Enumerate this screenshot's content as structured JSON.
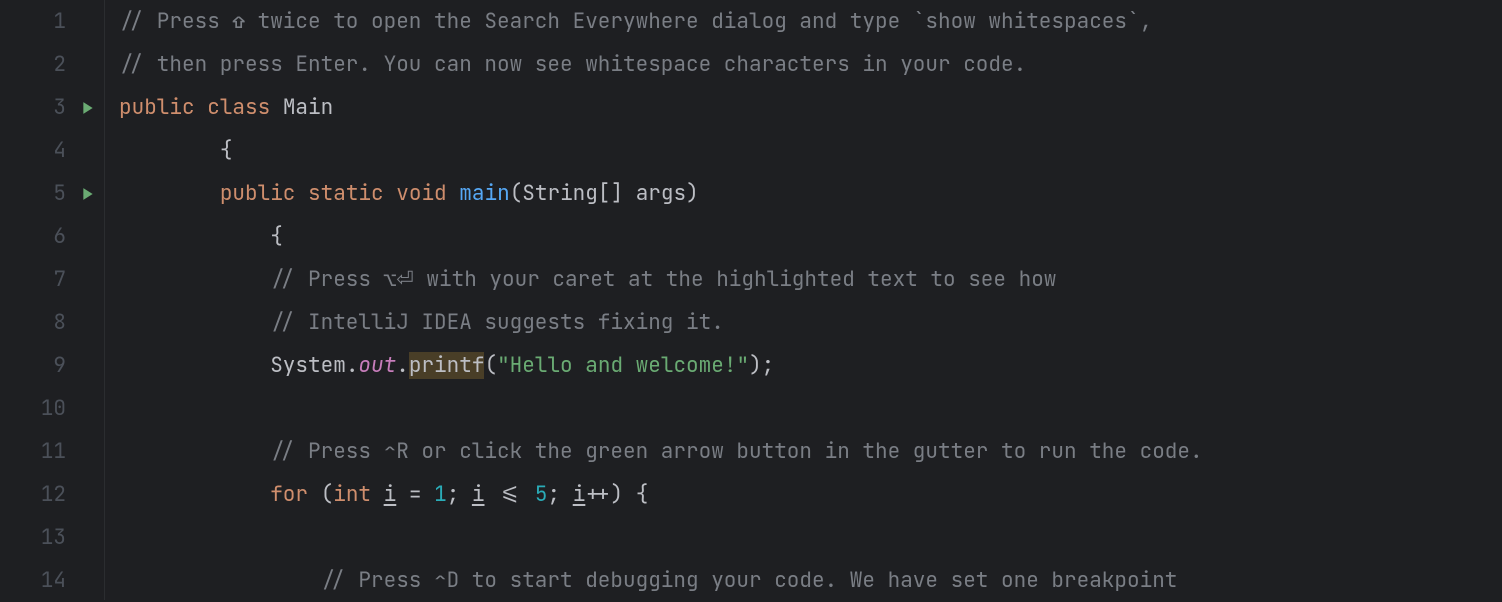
{
  "lines": {
    "1": {
      "number": "1",
      "run": false
    },
    "2": {
      "number": "2",
      "run": false
    },
    "3": {
      "number": "3",
      "run": true
    },
    "4": {
      "number": "4",
      "run": false
    },
    "5": {
      "number": "5",
      "run": true
    },
    "6": {
      "number": "6",
      "run": false
    },
    "7": {
      "number": "7",
      "run": false
    },
    "8": {
      "number": "8",
      "run": false
    },
    "9": {
      "number": "9",
      "run": false
    },
    "10": {
      "number": "10",
      "run": false
    },
    "11": {
      "number": "11",
      "run": false
    },
    "12": {
      "number": "12",
      "run": false
    },
    "13": {
      "number": "13",
      "run": false
    },
    "14": {
      "number": "14",
      "run": false
    }
  },
  "code": {
    "l1": {
      "comment": "// Press ⇧ twice to open the Search Everywhere dialog and type `show whitespaces`,"
    },
    "l2": {
      "comment": "// then press Enter. You can now see whitespace characters in your code."
    },
    "l3": {
      "kw_public": "public",
      "kw_class": "class",
      "name": "Main"
    },
    "l4": {
      "brace": "{"
    },
    "l5": {
      "kw_public": "public",
      "kw_static": "static",
      "kw_void": "void",
      "method": "main",
      "params_open": "(",
      "type": "String",
      "brackets": "[]",
      "arg": " args",
      "params_close": ")"
    },
    "l6": {
      "brace": "{"
    },
    "l7": {
      "comment": "// Press ⌥⏎ with your caret at the highlighted text to see how"
    },
    "l8": {
      "comment": "// IntelliJ IDEA suggests fixing it."
    },
    "l9": {
      "system": "System",
      "dot1": ".",
      "out": "out",
      "dot2": ".",
      "printf": "printf",
      "paren_open": "(",
      "str": "\"Hello and welcome!\"",
      "paren_close": ")",
      "semi": ";"
    },
    "l11": {
      "comment": "// Press ⌃R or click the green arrow button in the gutter to run the code."
    },
    "l12": {
      "kw_for": "for",
      "sp": " ",
      "paren_open": "(",
      "kw_int": "int",
      "sp2": " ",
      "i1": "i",
      "eq": " = ",
      "n1": "1",
      "semi1": "; ",
      "i2": "i",
      "lte": " <= ",
      "n5": "5",
      "semi2": "; ",
      "i3": "i",
      "pp": "++",
      "paren_close": ")",
      "sp3": " ",
      "brace": "{"
    },
    "l14": {
      "comment": "// Press ⌃D to start debugging your code. We have set one breakpoint"
    }
  }
}
